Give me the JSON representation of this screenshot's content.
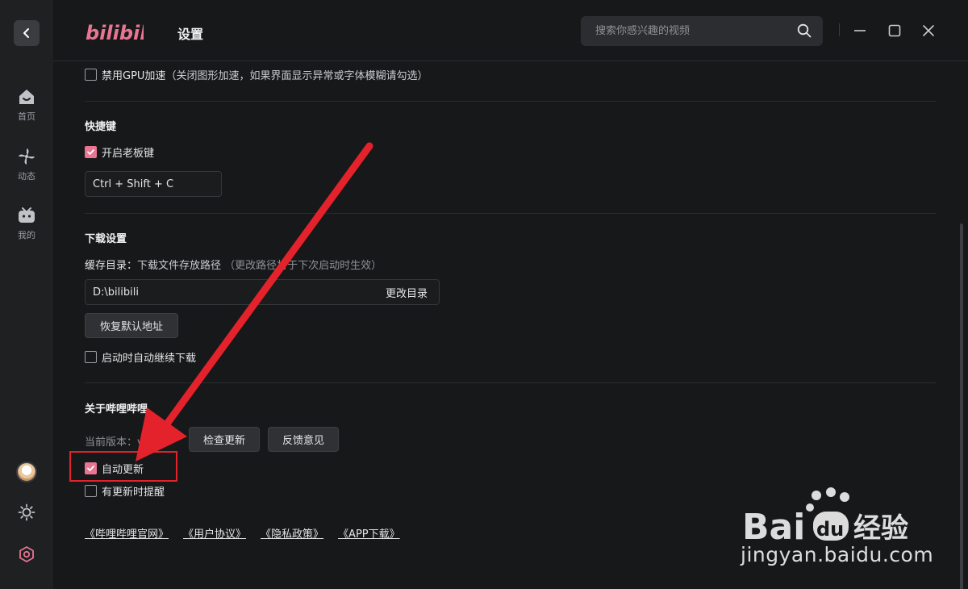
{
  "app": {
    "logo_text": "bilibili",
    "page_title": "设置",
    "search_placeholder": "搜索你感兴趣的视频",
    "accent_color": "#e87592"
  },
  "sidebar": {
    "items": [
      {
        "label": "首页",
        "icon": "home-icon"
      },
      {
        "label": "动态",
        "icon": "pinwheel-icon"
      },
      {
        "label": "我的",
        "icon": "tv-icon"
      }
    ],
    "bottom_icons": [
      "avatar",
      "theme-sun-icon",
      "settings-icon"
    ]
  },
  "settings": {
    "gpu": {
      "label": "禁用GPU加速",
      "hint": "（关闭图形加速，如果界面显示异常或字体模糊请勾选）",
      "checked": false
    },
    "shortcut": {
      "title": "快捷键",
      "boss_key_label": "开启老板键",
      "boss_key_checked": true,
      "key_combo": "Ctrl + Shift + C"
    },
    "download": {
      "title": "下载设置",
      "cache_label": "缓存目录：",
      "cache_desc": "下载文件存放路径",
      "cache_hint": "（更改路径将于下次启动时生效）",
      "path": "D:\\bilibili",
      "change_dir_label": "更改目录",
      "restore_default_label": "恢复默认地址",
      "auto_resume_label": "启动时自动继续下载",
      "auto_resume_checked": false
    },
    "about": {
      "title": "关于哔哩哔哩",
      "version_label": "当前版本：v",
      "check_update_label": "检查更新",
      "feedback_label": "反馈意见",
      "auto_update_label": "自动更新",
      "auto_update_checked": true,
      "update_notice_label": "有更新时提醒",
      "update_notice_checked": false
    },
    "links": [
      "《哔哩哔哩官网》",
      "《用户协议》",
      "《隐私政策》",
      "《APP下载》"
    ]
  },
  "watermark": {
    "brand": "Bai 经验",
    "url": "jingyan.baidu.com"
  }
}
